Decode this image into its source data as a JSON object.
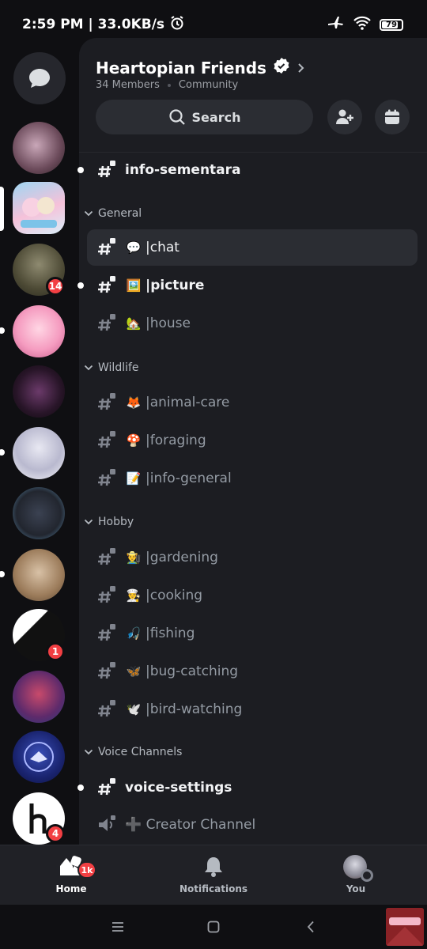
{
  "status_bar": {
    "time_speed": "2:59 PM | 33.0KB/s",
    "battery": "79",
    "icons": [
      "alarm-icon",
      "airplane-icon",
      "wifi-icon",
      "battery-icon"
    ]
  },
  "server": {
    "name": "Heartopian Friends",
    "members": "34 Members",
    "type": "Community",
    "search_label": "Search"
  },
  "rail": {
    "badges": [
      "14",
      "1",
      "4"
    ]
  },
  "channels": {
    "top": [
      {
        "label": "info-sementara",
        "emoji": "",
        "unread": true
      }
    ],
    "categories": [
      {
        "name": "General",
        "items": [
          {
            "label": "chat",
            "emoji": "💬",
            "selected": true
          },
          {
            "label": "picture",
            "emoji": "🖼️",
            "unread": true
          },
          {
            "label": "house",
            "emoji": "🏡"
          }
        ]
      },
      {
        "name": "Wildlife",
        "items": [
          {
            "label": "animal-care",
            "emoji": "🦊"
          },
          {
            "label": "foraging",
            "emoji": "🍄"
          },
          {
            "label": "info-general",
            "emoji": "📝"
          }
        ]
      },
      {
        "name": "Hobby",
        "items": [
          {
            "label": "gardening",
            "emoji": "👨‍🌾"
          },
          {
            "label": "cooking",
            "emoji": "👨‍🍳"
          },
          {
            "label": "fishing",
            "emoji": "🎣"
          },
          {
            "label": "bug-catching",
            "emoji": "🦋"
          },
          {
            "label": "bird-watching",
            "emoji": "🕊️"
          }
        ]
      },
      {
        "name": "Voice Channels",
        "items": [
          {
            "label": "voice-settings",
            "emoji": "",
            "unread": true
          },
          {
            "label": "➕ Creator Channel",
            "emoji": "",
            "voice": true
          }
        ]
      }
    ]
  },
  "bottom_nav": {
    "home": "Home",
    "home_badge": "1k",
    "notifications": "Notifications",
    "you": "You"
  },
  "colors": {
    "background": "#0f0f12",
    "panel": "#1c1d22",
    "accent_red": "#f23f43",
    "muted_text": "#949ba4"
  }
}
